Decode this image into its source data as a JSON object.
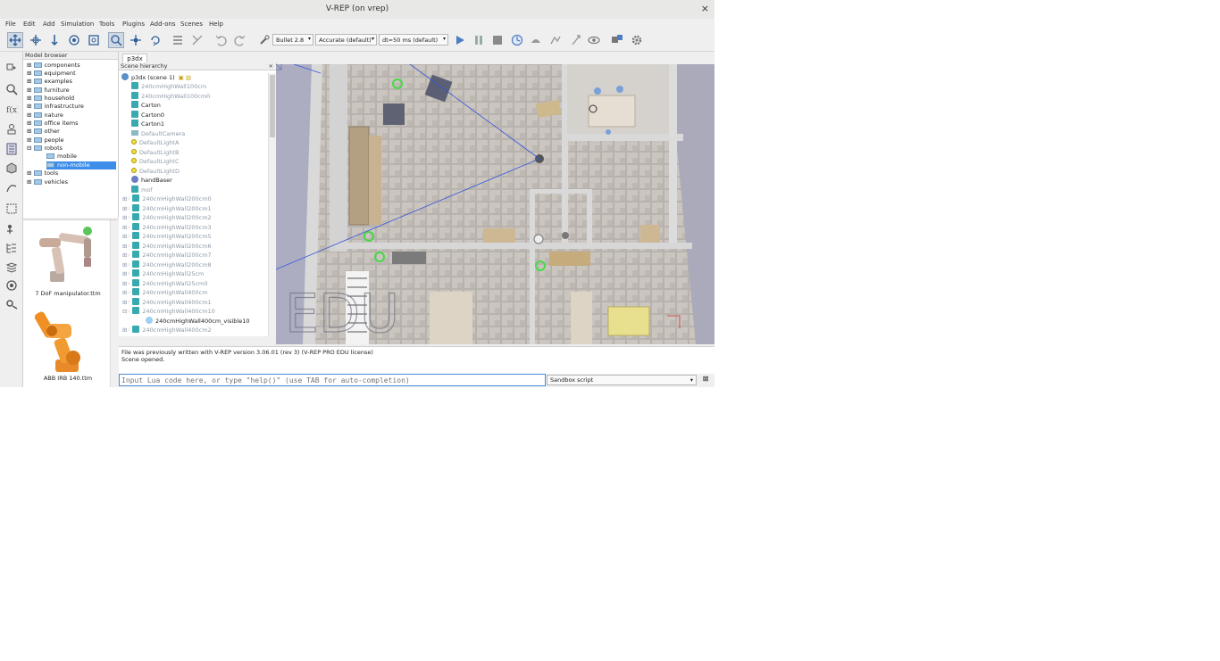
{
  "window": {
    "title": "V-REP (on vrep)",
    "close_glyph": "×"
  },
  "menu": [
    "File",
    "Edit",
    "Add",
    "Simulation",
    "Tools",
    "Plugins",
    "Add-ons",
    "Scenes",
    "Help"
  ],
  "toolbar": {
    "engine": "Bullet 2.8",
    "accuracy": "Accurate (default)",
    "timestep": "dt=50 ms (default)"
  },
  "model_browser": {
    "title": "Model browser",
    "items": [
      "components",
      "equipment",
      "examples",
      "furniture",
      "household",
      "infrastructure",
      "nature",
      "office items",
      "other",
      "people",
      "robots",
      "mobile",
      "non-mobile",
      "tools",
      "vehicles"
    ],
    "selected": "non-mobile"
  },
  "thumbnails": [
    {
      "caption": "7 DoF manipulator.ttm"
    },
    {
      "caption": "ABB IRB 140.ttm"
    }
  ],
  "scene_tab": "p3dx",
  "hierarchy": {
    "title": "Scene hierarchy",
    "root": "p3dx (scene 1)",
    "items": [
      {
        "label": "240cmHighWall100cm",
        "kind": "shape",
        "faded": true
      },
      {
        "label": "240cmHighWall100cm0",
        "kind": "shape",
        "faded": true
      },
      {
        "label": "Carton",
        "kind": "shape",
        "faded": false
      },
      {
        "label": "Carton0",
        "kind": "shape",
        "faded": false
      },
      {
        "label": "Carton1",
        "kind": "shape",
        "faded": false
      },
      {
        "label": "DefaultCamera",
        "kind": "camera",
        "faded": true
      },
      {
        "label": "DefaultLightA",
        "kind": "light",
        "faded": true
      },
      {
        "label": "DefaultLightB",
        "kind": "light",
        "faded": true
      },
      {
        "label": "DefaultLightC",
        "kind": "light",
        "faded": true
      },
      {
        "label": "DefaultLightD",
        "kind": "light",
        "faded": true
      },
      {
        "label": "handBaser",
        "kind": "robot",
        "faded": false
      },
      {
        "label": "mof",
        "kind": "shape",
        "faded": true
      },
      {
        "label": "240cmHighWall200cm0",
        "kind": "shape",
        "faded": true
      },
      {
        "label": "240cmHighWall200cm1",
        "kind": "shape",
        "faded": true
      },
      {
        "label": "240cmHighWall200cm2",
        "kind": "shape",
        "faded": true
      },
      {
        "label": "240cmHighWall200cm3",
        "kind": "shape",
        "faded": true
      },
      {
        "label": "240cmHighWall200cm5",
        "kind": "shape",
        "faded": true
      },
      {
        "label": "240cmHighWall200cm6",
        "kind": "shape",
        "faded": true
      },
      {
        "label": "240cmHighWall200cm7",
        "kind": "shape",
        "faded": true
      },
      {
        "label": "240cmHighWall200cm8",
        "kind": "shape",
        "faded": true
      },
      {
        "label": "240cmHighWall25cm",
        "kind": "shape",
        "faded": true
      },
      {
        "label": "240cmHighWall25cm0",
        "kind": "shape",
        "faded": true
      },
      {
        "label": "240cmHighWall400cm",
        "kind": "shape",
        "faded": true
      },
      {
        "label": "240cmHighWall400cm1",
        "kind": "shape",
        "faded": true
      },
      {
        "label": "240cmHighWall400cm10",
        "kind": "shape",
        "faded": true
      },
      {
        "label": "240cmHighWall400cm_visible10",
        "kind": "sub",
        "faded": false
      },
      {
        "label": "240cmHighWall400cm2",
        "kind": "shape",
        "faded": true
      }
    ]
  },
  "viewport": {
    "watermark": "EDU"
  },
  "console": {
    "lines": [
      "File was previously written with V-REP version 3.06.01 (rev 3) (V-REP PRO EDU license)",
      "Scene opened."
    ]
  },
  "lua": {
    "placeholder": "Input Lua code here, or type \"help()\" (use TAB for auto-completion)"
  },
  "script_selector": "Sandbox script",
  "colors": {
    "selection": "#3d8ee8",
    "accent_blue": "#4e8ad8",
    "shape_icon": "#39a9b0"
  }
}
